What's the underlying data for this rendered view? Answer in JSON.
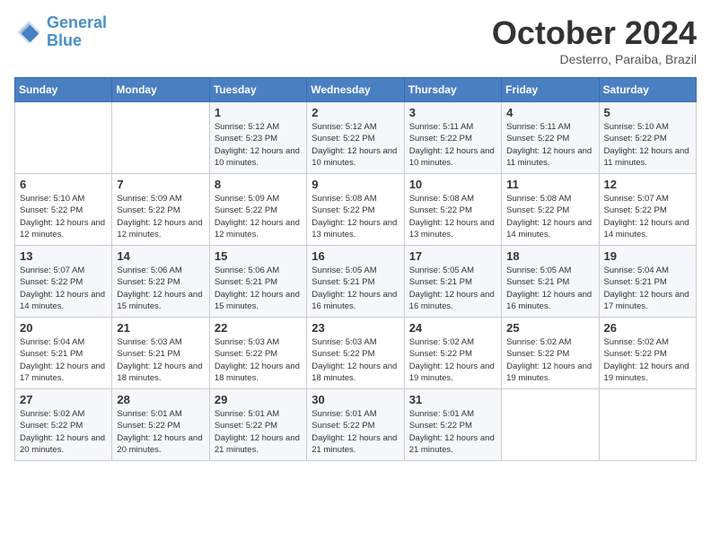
{
  "logo": {
    "line1": "General",
    "line2": "Blue"
  },
  "title": "October 2024",
  "subtitle": "Desterro, Paraiba, Brazil",
  "weekdays": [
    "Sunday",
    "Monday",
    "Tuesday",
    "Wednesday",
    "Thursday",
    "Friday",
    "Saturday"
  ],
  "weeks": [
    [
      {
        "day": "",
        "info": ""
      },
      {
        "day": "",
        "info": ""
      },
      {
        "day": "1",
        "info": "Sunrise: 5:12 AM\nSunset: 5:23 PM\nDaylight: 12 hours and 10 minutes."
      },
      {
        "day": "2",
        "info": "Sunrise: 5:12 AM\nSunset: 5:22 PM\nDaylight: 12 hours and 10 minutes."
      },
      {
        "day": "3",
        "info": "Sunrise: 5:11 AM\nSunset: 5:22 PM\nDaylight: 12 hours and 10 minutes."
      },
      {
        "day": "4",
        "info": "Sunrise: 5:11 AM\nSunset: 5:22 PM\nDaylight: 12 hours and 11 minutes."
      },
      {
        "day": "5",
        "info": "Sunrise: 5:10 AM\nSunset: 5:22 PM\nDaylight: 12 hours and 11 minutes."
      }
    ],
    [
      {
        "day": "6",
        "info": "Sunrise: 5:10 AM\nSunset: 5:22 PM\nDaylight: 12 hours and 12 minutes."
      },
      {
        "day": "7",
        "info": "Sunrise: 5:09 AM\nSunset: 5:22 PM\nDaylight: 12 hours and 12 minutes."
      },
      {
        "day": "8",
        "info": "Sunrise: 5:09 AM\nSunset: 5:22 PM\nDaylight: 12 hours and 12 minutes."
      },
      {
        "day": "9",
        "info": "Sunrise: 5:08 AM\nSunset: 5:22 PM\nDaylight: 12 hours and 13 minutes."
      },
      {
        "day": "10",
        "info": "Sunrise: 5:08 AM\nSunset: 5:22 PM\nDaylight: 12 hours and 13 minutes."
      },
      {
        "day": "11",
        "info": "Sunrise: 5:08 AM\nSunset: 5:22 PM\nDaylight: 12 hours and 14 minutes."
      },
      {
        "day": "12",
        "info": "Sunrise: 5:07 AM\nSunset: 5:22 PM\nDaylight: 12 hours and 14 minutes."
      }
    ],
    [
      {
        "day": "13",
        "info": "Sunrise: 5:07 AM\nSunset: 5:22 PM\nDaylight: 12 hours and 14 minutes."
      },
      {
        "day": "14",
        "info": "Sunrise: 5:06 AM\nSunset: 5:22 PM\nDaylight: 12 hours and 15 minutes."
      },
      {
        "day": "15",
        "info": "Sunrise: 5:06 AM\nSunset: 5:21 PM\nDaylight: 12 hours and 15 minutes."
      },
      {
        "day": "16",
        "info": "Sunrise: 5:05 AM\nSunset: 5:21 PM\nDaylight: 12 hours and 16 minutes."
      },
      {
        "day": "17",
        "info": "Sunrise: 5:05 AM\nSunset: 5:21 PM\nDaylight: 12 hours and 16 minutes."
      },
      {
        "day": "18",
        "info": "Sunrise: 5:05 AM\nSunset: 5:21 PM\nDaylight: 12 hours and 16 minutes."
      },
      {
        "day": "19",
        "info": "Sunrise: 5:04 AM\nSunset: 5:21 PM\nDaylight: 12 hours and 17 minutes."
      }
    ],
    [
      {
        "day": "20",
        "info": "Sunrise: 5:04 AM\nSunset: 5:21 PM\nDaylight: 12 hours and 17 minutes."
      },
      {
        "day": "21",
        "info": "Sunrise: 5:03 AM\nSunset: 5:21 PM\nDaylight: 12 hours and 18 minutes."
      },
      {
        "day": "22",
        "info": "Sunrise: 5:03 AM\nSunset: 5:22 PM\nDaylight: 12 hours and 18 minutes."
      },
      {
        "day": "23",
        "info": "Sunrise: 5:03 AM\nSunset: 5:22 PM\nDaylight: 12 hours and 18 minutes."
      },
      {
        "day": "24",
        "info": "Sunrise: 5:02 AM\nSunset: 5:22 PM\nDaylight: 12 hours and 19 minutes."
      },
      {
        "day": "25",
        "info": "Sunrise: 5:02 AM\nSunset: 5:22 PM\nDaylight: 12 hours and 19 minutes."
      },
      {
        "day": "26",
        "info": "Sunrise: 5:02 AM\nSunset: 5:22 PM\nDaylight: 12 hours and 19 minutes."
      }
    ],
    [
      {
        "day": "27",
        "info": "Sunrise: 5:02 AM\nSunset: 5:22 PM\nDaylight: 12 hours and 20 minutes."
      },
      {
        "day": "28",
        "info": "Sunrise: 5:01 AM\nSunset: 5:22 PM\nDaylight: 12 hours and 20 minutes."
      },
      {
        "day": "29",
        "info": "Sunrise: 5:01 AM\nSunset: 5:22 PM\nDaylight: 12 hours and 21 minutes."
      },
      {
        "day": "30",
        "info": "Sunrise: 5:01 AM\nSunset: 5:22 PM\nDaylight: 12 hours and 21 minutes."
      },
      {
        "day": "31",
        "info": "Sunrise: 5:01 AM\nSunset: 5:22 PM\nDaylight: 12 hours and 21 minutes."
      },
      {
        "day": "",
        "info": ""
      },
      {
        "day": "",
        "info": ""
      }
    ]
  ]
}
